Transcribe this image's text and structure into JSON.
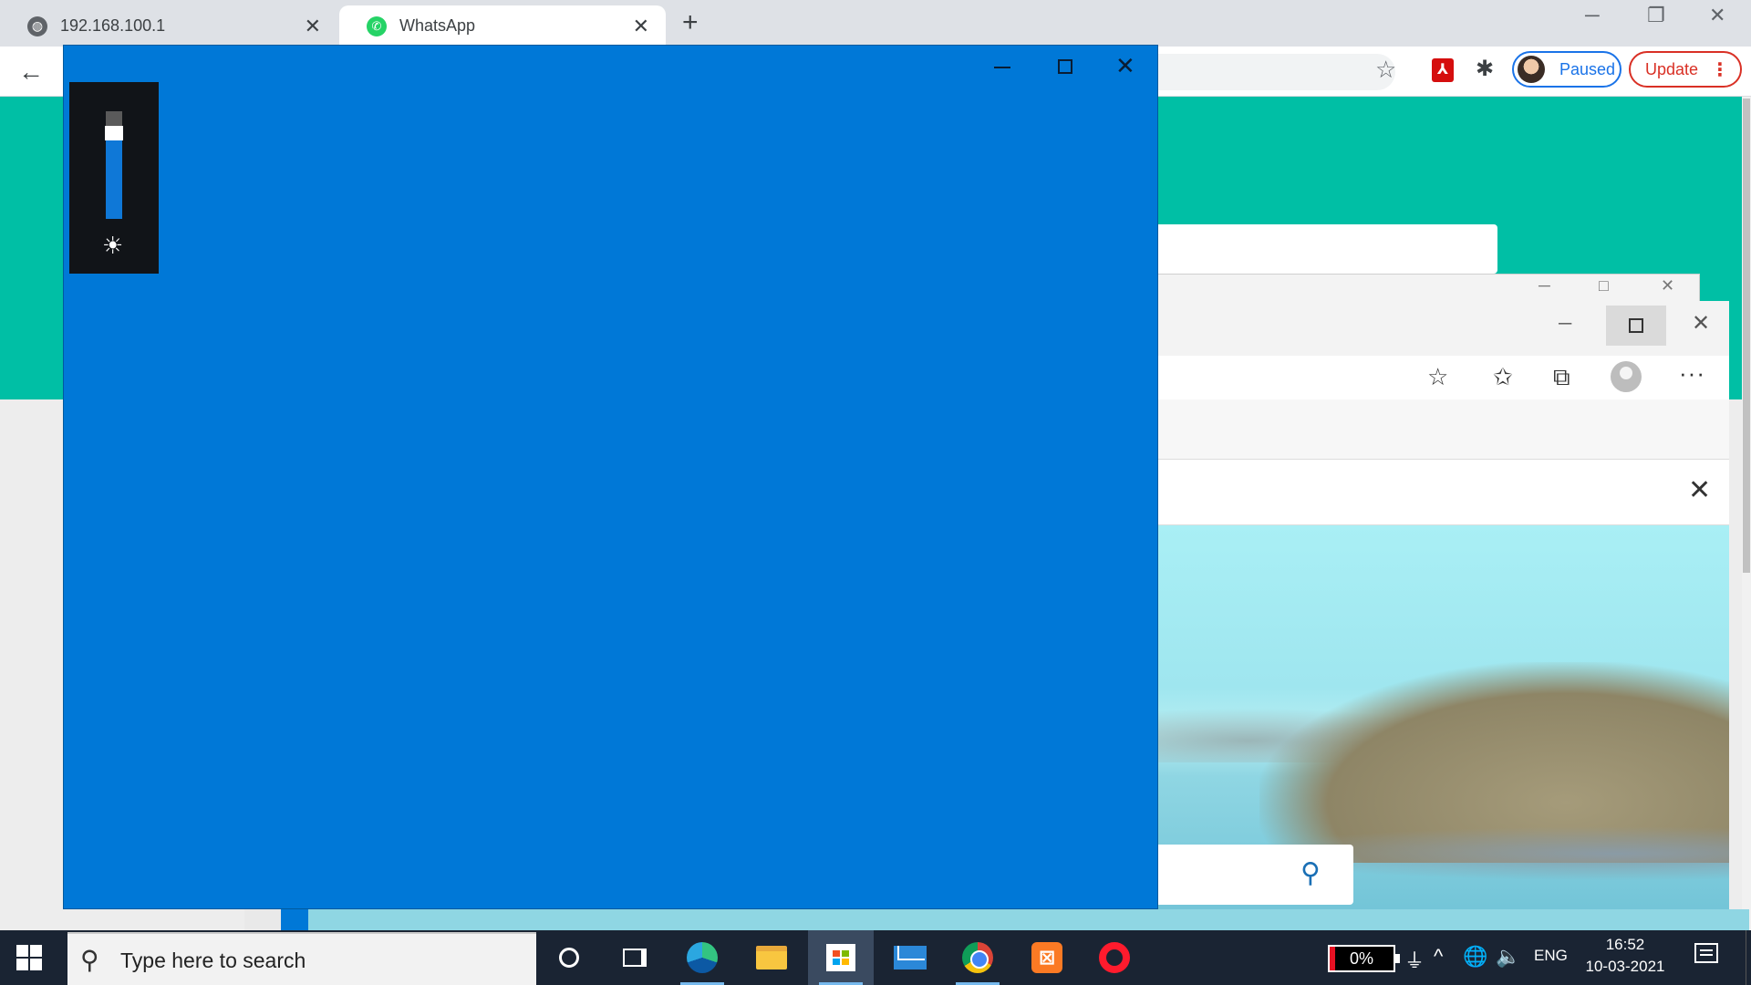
{
  "chrome": {
    "tabs": [
      {
        "title": "192.168.100.1",
        "icon": "globe-icon",
        "active": false
      },
      {
        "title": "WhatsApp",
        "icon": "whatsapp-icon",
        "active": true
      }
    ],
    "new_tab_symbol": "+",
    "close_symbol": "✕",
    "window_controls": {
      "minimize": "─",
      "restore": "❐",
      "close": "✕"
    },
    "toolbar": {
      "back_symbol": "←",
      "star_symbol": "☆",
      "pdf_ext_symbol": "⅄",
      "extensions_symbol": "✱",
      "profile_status": "Paused",
      "update_label": "Update",
      "menu_symbol": "⋮"
    }
  },
  "foreground_window": {
    "background_color": "#0078d7",
    "controls": {
      "close": "✕"
    },
    "brightness": {
      "level_percent": 80,
      "icon": "sun-icon",
      "sun_symbol": "☀"
    }
  },
  "edge_window": {
    "controls": {
      "minimize": "─",
      "close": "✕"
    },
    "toolbar_icons": [
      "add-favorite-icon",
      "favorites-icon",
      "collections-icon",
      "profile-icon",
      "more-icon"
    ],
    "toolbar_symbols": {
      "add_favorite": "☆",
      "favorites": "✩",
      "collections": "⧉",
      "more": "···"
    },
    "infobar_close": "✕",
    "search_symbol": "⚲"
  },
  "behind_window_controls": {
    "minimize": "─",
    "maximize": "□",
    "close": "✕"
  },
  "taskbar": {
    "search_placeholder": "Type here to search",
    "search_symbol": "⚲",
    "pinned_apps": [
      "cortana",
      "task-view",
      "microsoft-edge",
      "file-explorer",
      "microsoft-store",
      "mail",
      "google-chrome",
      "xampp",
      "opera"
    ],
    "battery_percent": "0%",
    "tray_symbols": {
      "plug": "⏚",
      "chevron": "^",
      "network": "🌐",
      "volume": "🔈"
    },
    "language": "ENG",
    "time": "16:52",
    "date": "10-03-2021"
  }
}
